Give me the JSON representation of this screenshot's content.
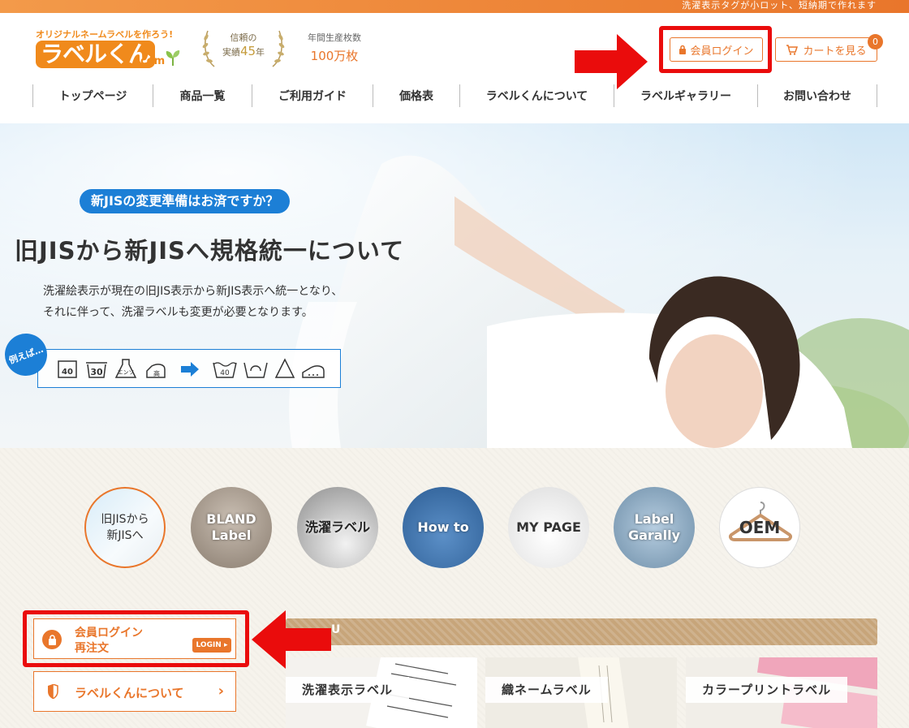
{
  "topbar": {
    "text": "洗濯表示タグが小ロット、短納期で作れます"
  },
  "logo": {
    "tagline": "オリジナルネームラベルを作ろう!",
    "name": "ラベルくん",
    "domain": ".com"
  },
  "trust": {
    "line1": "信頼の",
    "line2_prefix": "実績",
    "years": "45",
    "line2_suffix": "年"
  },
  "annual": {
    "label": "年間生産枚数",
    "value": "100万枚"
  },
  "header_buttons": {
    "login_label": "会員ログイン",
    "cart_label": "カートを見る",
    "cart_count": "0"
  },
  "nav": {
    "items": [
      {
        "label": "トップページ"
      },
      {
        "label": "商品一覧"
      },
      {
        "label": "ご利用ガイド"
      },
      {
        "label": "価格表"
      },
      {
        "label": "ラベルくんについて"
      },
      {
        "label": "ラベルギャラリー"
      },
      {
        "label": "お問い合わせ"
      }
    ]
  },
  "hero": {
    "pill": "新JISの変更準備はお済ですか？",
    "title": "旧JISから新JISへ規格統一について",
    "desc_line1": "洗濯絵表示が現在の旧JIS表示から新JIS表示へ統一となり、",
    "desc_line2": "それに伴って、洗濯ラベルも変更が必要となります。",
    "example_badge": "例えば…",
    "old_symbols": [
      "40",
      "30",
      "エンソ",
      "高"
    ],
    "new_symbols": [
      "40"
    ]
  },
  "circles": [
    {
      "line1": "旧JISから",
      "line2": "新JISへ"
    },
    {
      "line1": "BLAND",
      "line2": "Label"
    },
    {
      "line1": "洗濯ラベル",
      "line2": ""
    },
    {
      "line1": "How to",
      "line2": ""
    },
    {
      "line1": "MY PAGE",
      "line2": ""
    },
    {
      "line1": "Label",
      "line2": "Garally"
    },
    {
      "line1": "OEM",
      "line2": ""
    }
  ],
  "sidebar": {
    "login_line1": "会員ログイン",
    "login_line2": "再注文",
    "login_tag": "LOGIN ▸",
    "about_label": "ラベルくんについて"
  },
  "menu_bar": {
    "text": "U"
  },
  "products": [
    {
      "label": "洗濯表示ラベル"
    },
    {
      "label": "織ネームラベル"
    },
    {
      "label": "カラープリントラベル"
    }
  ],
  "colors": {
    "accent": "#e9762b",
    "blue": "#1c7fd6",
    "highlight_red": "#ea0c0c"
  }
}
